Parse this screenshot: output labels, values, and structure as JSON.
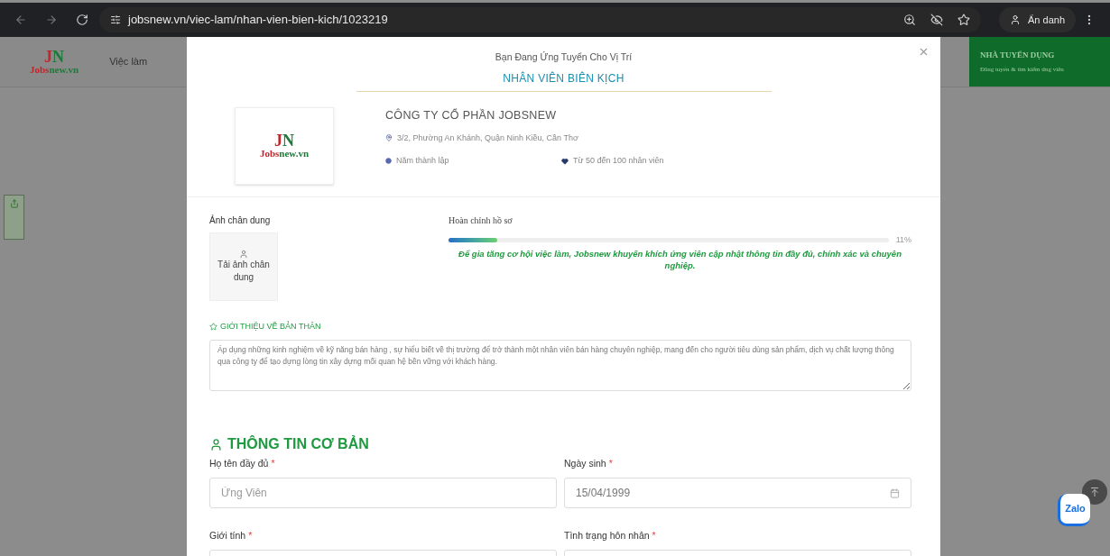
{
  "browser": {
    "url": "jobsnew.vn/viec-lam/nhan-vien-bien-kich/1023219",
    "profile": "Ẩn danh"
  },
  "header": {
    "logo_mark": "JN",
    "logo_text": "Jobsnew.vn",
    "nav": [
      "Việc làm"
    ],
    "employer": {
      "title": "NHÀ TUYỂN DỤNG",
      "subtitle": "Đăng tuyển & tìm kiếm ứng viên"
    }
  },
  "modal": {
    "subtitle": "Bạn Đang Ứng Tuyển Cho Vị Trí",
    "position": "NHÂN VIÊN BIÊN KỊCH",
    "company": {
      "logo_mark": "JN",
      "logo_text": "Jobsnew.vn",
      "name": "CÔNG TY CỔ PHẦN JOBSNEW",
      "address": "3/2, Phường An Khánh, Quận Ninh Kiều, Cần Thơ",
      "founded": "Năm thành lập",
      "size": "Từ 50 đến 100 nhân viên"
    },
    "portrait": {
      "label": "Ảnh chân dung",
      "upload": "Tải ảnh chân dung"
    },
    "progress": {
      "label": "Hoàn chỉnh hồ sơ",
      "level": 0.11,
      "reading": "11%",
      "hint": "Để gia tăng cơ hội việc làm, Jobsnew khuyến khích ứng viên cập nhật thông tin đầy đủ, chính xác và chuyên nghiệp."
    },
    "intro": {
      "heading": "GIỚI THIỆU VỀ BẢN THÂN",
      "value": "Áp dụng những kinh nghiệm về kỹ năng bán hàng , sự hiểu biết về thị trường để trở thành một nhân viên bán hàng chuyên nghiệp, mang đến cho người tiêu dùng sản phẩm, dịch vụ chất lượng thông qua công ty để tạo dựng lòng tin xây dựng mối quan hệ bền vững với khách hàng."
    },
    "basic": {
      "heading": "THÔNG TIN CƠ BẢN",
      "fields": [
        {
          "kind": "text",
          "label": "Họ tên đầy đủ",
          "required_mark": "*",
          "placeholder": "Ứng Viên"
        },
        {
          "kind": "date",
          "label": "Ngày sinh",
          "required_mark": "*",
          "value": "15/04/1999"
        },
        {
          "kind": "select",
          "label": "Giới tính",
          "required_mark": "*"
        },
        {
          "kind": "select",
          "label": "Tình trạng hôn nhân",
          "required_mark": "*"
        }
      ]
    }
  },
  "widgets": {
    "zalo": "Zalo"
  }
}
